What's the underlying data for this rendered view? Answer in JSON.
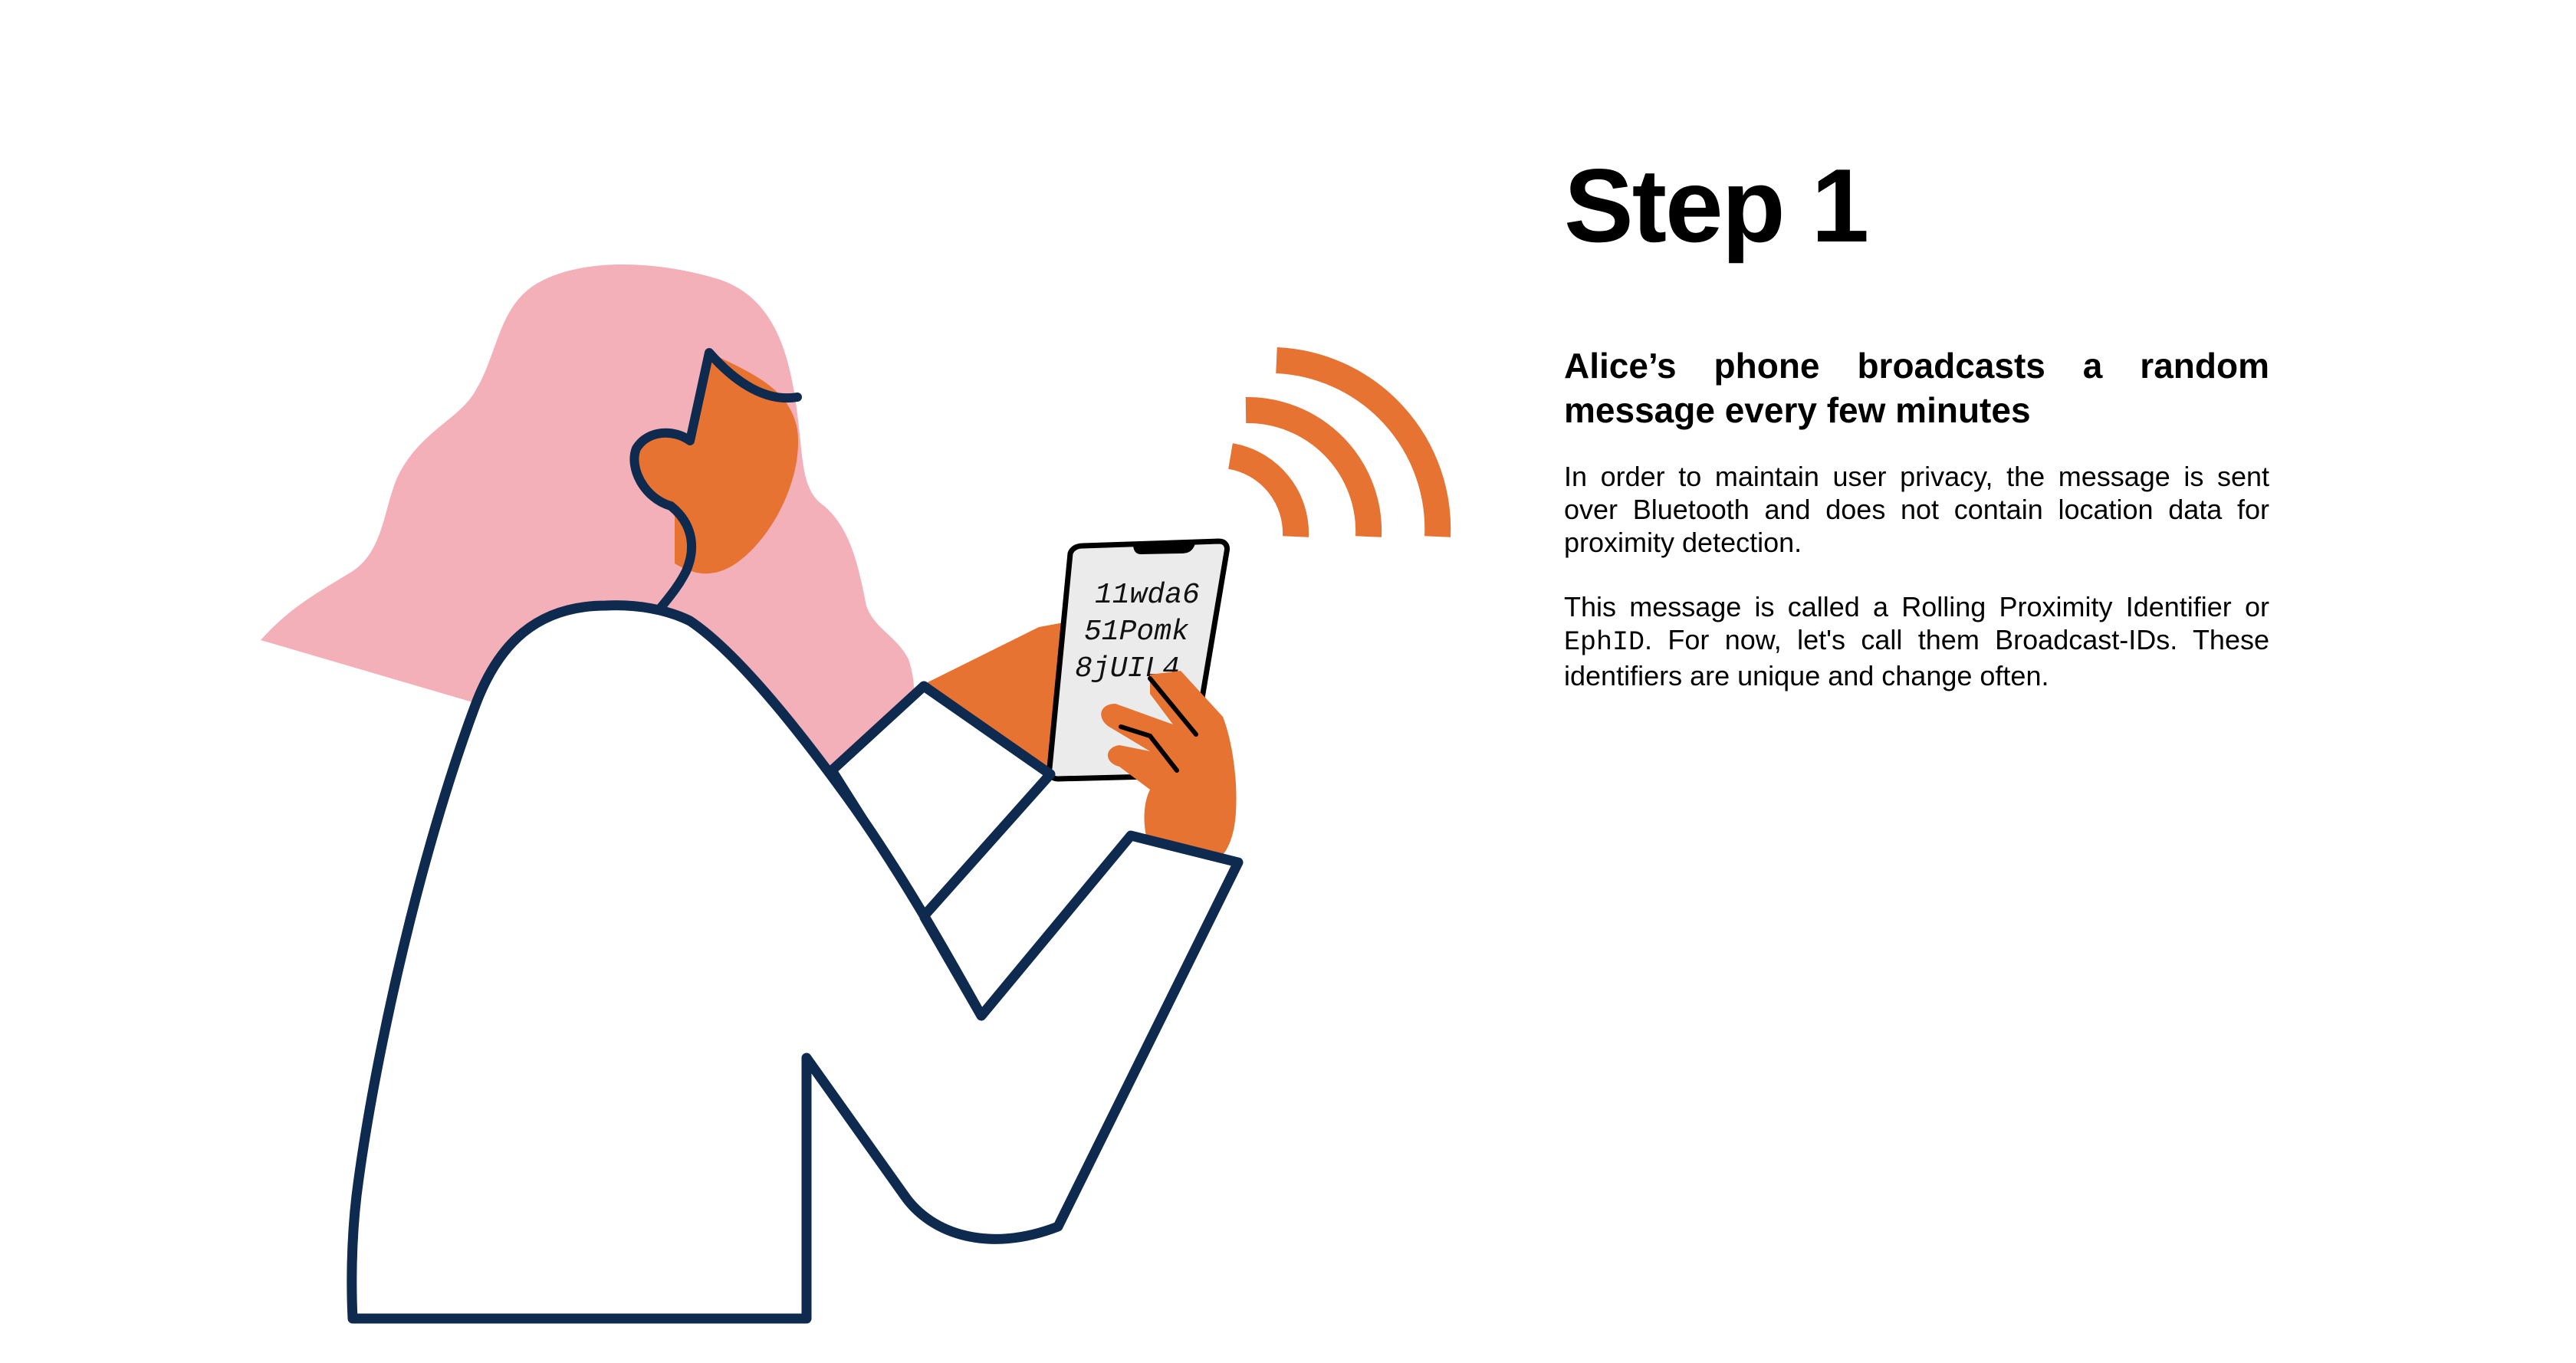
{
  "illustration": {
    "subject": "Alice",
    "phone_screen_lines": [
      "11wda6",
      "51Pomk",
      "8jUIL4"
    ],
    "colors": {
      "hair": "#F4B0B9",
      "skin": "#E67332",
      "outline": "#0E2A4F",
      "signal": "#E67332",
      "screen": "#EBEBEB"
    }
  },
  "content": {
    "title": "Step 1",
    "subtitle": "Alice’s phone broadcasts a random message every few minutes",
    "paragraph1": "In order to maintain user privacy, the message is sent over Bluetooth and does not contain location data for proximity detection.",
    "paragraph2_before": "This message is called a Rolling Proximity Identifier or ",
    "paragraph2_code": "EphID",
    "paragraph2_after": ". For now, let's call them Broadcast-IDs. These identifiers are unique and change often."
  }
}
